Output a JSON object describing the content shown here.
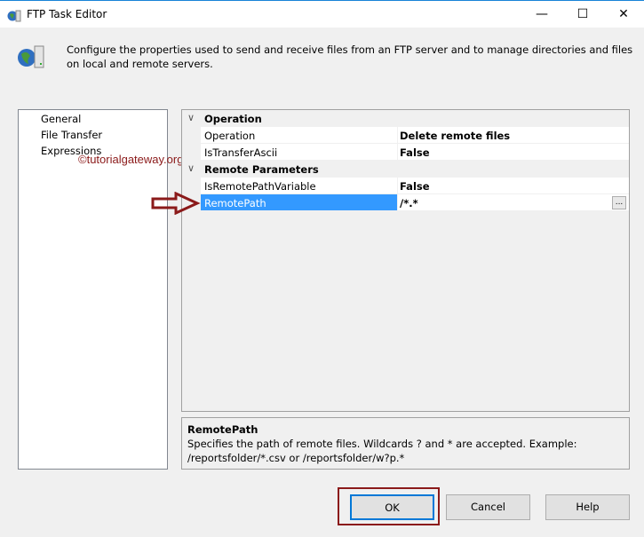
{
  "window": {
    "title": "FTP Task Editor",
    "minimize": "—",
    "maximize": "☐",
    "close": "✕"
  },
  "description": "Configure the properties used to send and receive files from an FTP server and to manage directories and files on local and remote servers.",
  "nav": {
    "items": [
      "General",
      "File Transfer",
      "Expressions"
    ]
  },
  "watermark": "©tutorialgateway.org",
  "grid": {
    "categories": [
      {
        "label": "Operation",
        "props": [
          {
            "name": "Operation",
            "value": "Delete remote files"
          },
          {
            "name": "IsTransferAscii",
            "value": "False"
          }
        ]
      },
      {
        "label": "Remote Parameters",
        "props": [
          {
            "name": "IsRemotePathVariable",
            "value": "False"
          },
          {
            "name": "RemotePath",
            "value": "/*.*"
          }
        ]
      }
    ],
    "ellipsis": "..."
  },
  "help": {
    "title": "RemotePath",
    "text": "Specifies the path of remote files. Wildcards ? and * are accepted. Example: /reportsfolder/*.csv or /reportsfolder/w?p.*"
  },
  "buttons": {
    "ok": "OK",
    "cancel": "Cancel",
    "help": "Help"
  },
  "colors": {
    "selection": "#3399ff",
    "annotation": "#8b1a1a",
    "focus": "#0078d7"
  }
}
